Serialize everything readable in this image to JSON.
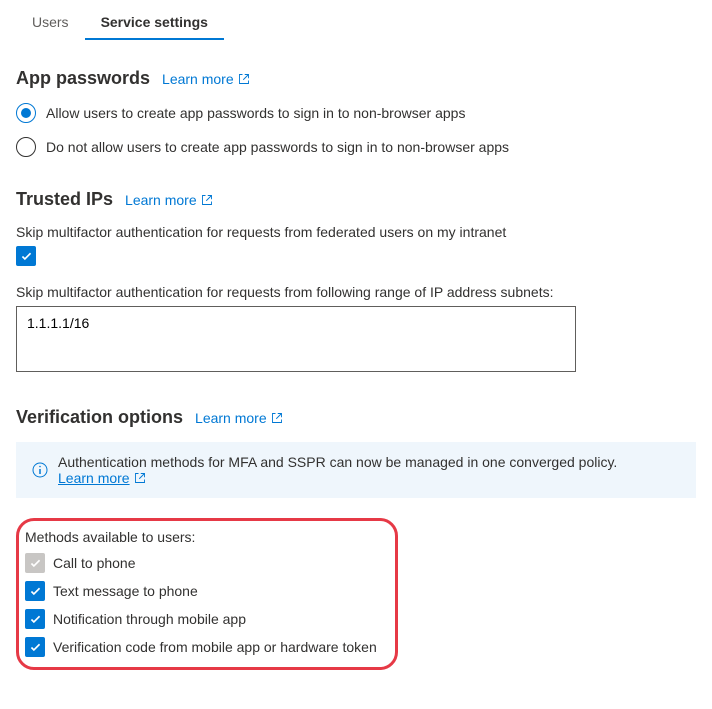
{
  "tabs": {
    "users": "Users",
    "service": "Service settings"
  },
  "appPasswords": {
    "title": "App passwords",
    "learnMore": "Learn more",
    "allow": "Allow users to create app passwords to sign in to non-browser apps",
    "deny": "Do not allow users to create app passwords to sign in to non-browser apps"
  },
  "trustedIps": {
    "title": "Trusted IPs",
    "learnMore": "Learn more",
    "skipFederated": "Skip multifactor authentication for requests from federated users on my intranet",
    "skipRangeLabel": "Skip multifactor authentication for requests from following range of IP address subnets:",
    "ipRangeValue": "1.1.1.1/16"
  },
  "verification": {
    "title": "Verification options",
    "learnMore": "Learn more",
    "infoText": "Authentication methods for MFA and SSPR can now be managed in one converged policy.",
    "infoLink": "Learn more",
    "methodsLabel": "Methods available to users:",
    "methods": {
      "call": "Call to phone",
      "text": "Text message to phone",
      "notification": "Notification through mobile app",
      "code": "Verification code from mobile app or hardware token"
    }
  }
}
